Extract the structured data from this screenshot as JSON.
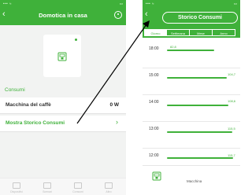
{
  "left": {
    "status": {
      "signal": "••• ≈",
      "time": "",
      "battery": "▭"
    },
    "nav": {
      "back": "‹",
      "title": "Domotica in casa"
    },
    "section_title": "Consumi",
    "rows": [
      {
        "label": "Macchina del caffè",
        "value": "0 W"
      },
      {
        "label": "Mostra Storico Consumi",
        "chevron": "›"
      }
    ],
    "tabs": [
      {
        "label": "Dispositivi"
      },
      {
        "label": "Scenari"
      },
      {
        "label": "Consumi"
      },
      {
        "label": "Altro"
      }
    ]
  },
  "right": {
    "status": {
      "signal": "••• ≈",
      "battery": "▭"
    },
    "nav": {
      "back": "‹",
      "title": "Storico Consumi"
    },
    "period_tabs": [
      "Giorno",
      "Settimana",
      "Mese",
      "Anno"
    ],
    "active_period": 0,
    "hours": [
      "18:00",
      "15:00",
      "14:00",
      "13:00",
      "12:00"
    ],
    "chart_data": {
      "type": "bar",
      "orientation": "horizontal",
      "x_max": 119,
      "values": [
        82.8,
        104.7,
        108.6,
        115.5,
        115.7
      ],
      "labels": [
        "82,8",
        "104,7",
        "108,6",
        "115,5",
        "115,7"
      ]
    },
    "footer_label": "Macchina"
  },
  "colors": {
    "green": "#3fb13a",
    "background": "#f2f3f2"
  },
  "icons": [
    "back-icon",
    "settings-icon",
    "coffee-machine-icon",
    "chevron-right-icon"
  ]
}
